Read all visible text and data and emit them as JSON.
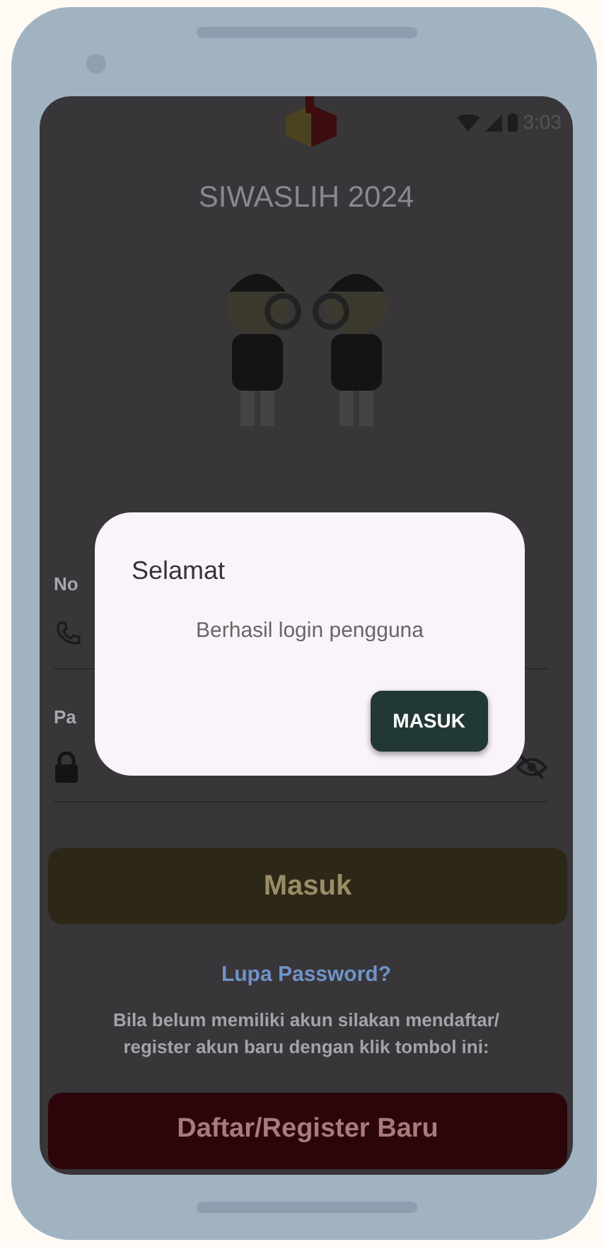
{
  "status_bar": {
    "time": "3:03"
  },
  "app_title": "SIWASLIH 2024",
  "form": {
    "fields": [
      {
        "label": "No",
        "kind": "phone"
      },
      {
        "label": "Pa",
        "kind": "password"
      }
    ]
  },
  "login_button": "Masuk",
  "forgot_link": "Lupa Password?",
  "register_hint": "Bila belum memiliki akun silakan mendaftar/ register akun baru dengan klik tombol ini:",
  "register_button": "Daftar/Register Baru",
  "dialog": {
    "title": "Selamat",
    "message": "Berhasil login pengguna",
    "button": "MASUK"
  }
}
